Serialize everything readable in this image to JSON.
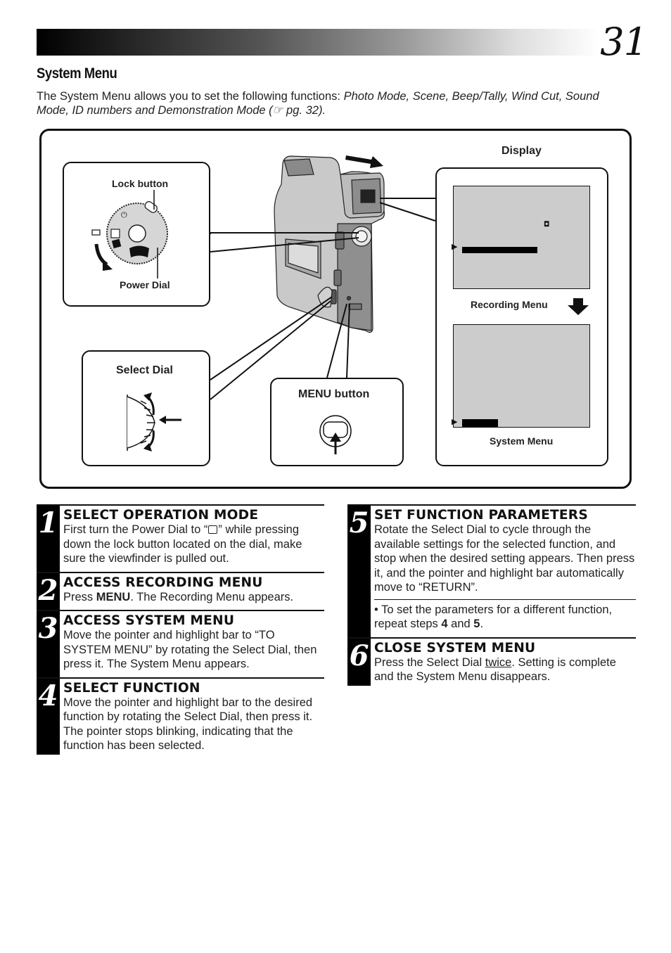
{
  "page": {
    "number": "31",
    "section_title": "System Menu",
    "intro": {
      "lead": "The System Menu allows you to set the following functions: ",
      "functions_italic": "Photo Mode, Scene, Beep/Tally, Wind Cut, Sound Mode, ID numbers and Demonstration Mode",
      "ref_open": " (",
      "ref_icon": "pointing-hand-icon",
      "ref_glyph": "☞",
      "ref_text": " pg. 32",
      "ref_close": ")."
    }
  },
  "diagram": {
    "callouts": {
      "power_dial": {
        "lock_label": "Lock button",
        "dial_label": "Power Dial"
      },
      "select_dial": {
        "label": "Select Dial"
      },
      "menu_button": {
        "label": "MENU button"
      },
      "display": {
        "title": "Display",
        "recording_menu_label": "Recording Menu",
        "system_menu_label": "System Menu"
      }
    }
  },
  "steps_left": [
    {
      "number": "1",
      "title": "SELECT OPERATION MODE",
      "text_a": "First turn the Power Dial to “",
      "text_b": "” while pressing down the lock button located on the dial, make sure the viewfinder is pulled out."
    },
    {
      "number": "2",
      "title": "ACCESS RECORDING MENU",
      "text_a": "Press ",
      "text_bold": "MENU",
      "text_b": ". The Recording Menu appears."
    },
    {
      "number": "3",
      "title": "ACCESS SYSTEM MENU",
      "text": "Move the pointer and highlight bar to “TO SYSTEM MENU” by rotating the Select Dial, then press it. The System Menu appears."
    },
    {
      "number": "4",
      "title": "SELECT FUNCTION",
      "text": "Move the pointer and highlight bar to the desired function by rotating the Select Dial, then press it. The pointer stops blinking, indicating that the function has been selected."
    }
  ],
  "steps_right": [
    {
      "number": "5",
      "title": "SET FUNCTION PARAMETERS",
      "text": "Rotate the Select Dial to cycle through the available settings for the selected function, and stop when the desired setting appears. Then press it, and the pointer and highlight bar automatically move to “RETURN”.",
      "note_a": "• To set the parameters for a different function, repeat steps ",
      "note_b1": "4",
      "note_mid": " and ",
      "note_b2": "5",
      "note_end": "."
    },
    {
      "number": "6",
      "title": "CLOSE SYSTEM MENU",
      "text_a": "Press the Select Dial ",
      "text_u": "twice",
      "text_b": ". Setting is complete and the System Menu disappears."
    }
  ]
}
